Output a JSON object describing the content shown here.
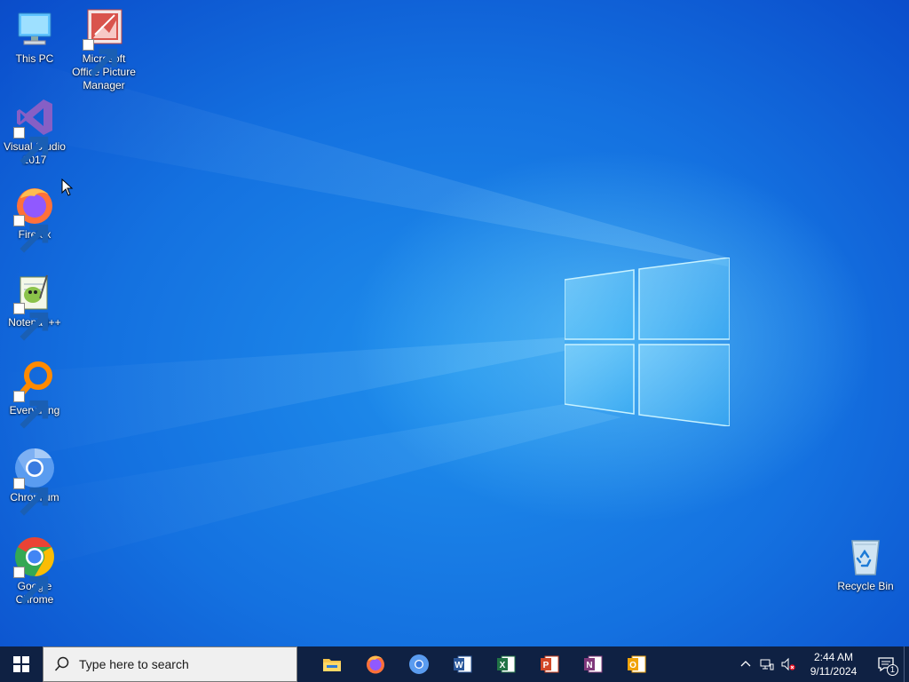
{
  "desktop": {
    "icons": [
      {
        "label": "This PC",
        "icon": "this-pc-icon"
      },
      {
        "label": "Microsoft Office Picture Manager",
        "icon": "picture-manager-icon"
      },
      {
        "label": "Visual Studio 2017",
        "icon": "visual-studio-icon"
      },
      {
        "label": "Firefox",
        "icon": "firefox-icon"
      },
      {
        "label": "Notepad++",
        "icon": "notepadpp-icon"
      },
      {
        "label": "Everything",
        "icon": "everything-icon"
      },
      {
        "label": "Chromium",
        "icon": "chromium-icon"
      },
      {
        "label": "Google Chrome",
        "icon": "chrome-icon"
      },
      {
        "label": "Recycle Bin",
        "icon": "recycle-bin-icon"
      }
    ]
  },
  "taskbar": {
    "search_placeholder": "Type here to search",
    "pinned": [
      "file-explorer-icon",
      "firefox-icon",
      "chromium-icon",
      "word-icon",
      "excel-icon",
      "powerpoint-icon",
      "onenote-icon",
      "outlook-icon"
    ],
    "clock": {
      "time": "2:44 AM",
      "date": "9/11/2024"
    },
    "notification_count": "1"
  },
  "colors": {
    "taskbar": "#0f2143",
    "desktop": "#1471e0"
  }
}
